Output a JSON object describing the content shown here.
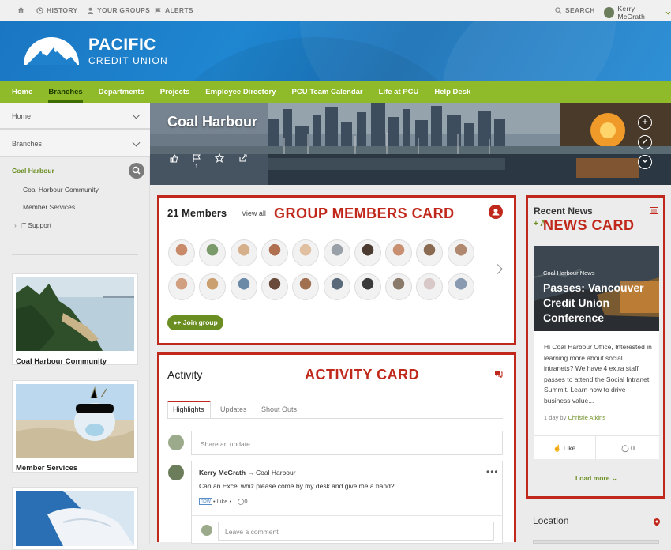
{
  "topbar": {
    "history": "HISTORY",
    "your_groups": "YOUR GROUPS",
    "alerts": "ALERTS",
    "search": "SEARCH",
    "user": "Kerry McGrath"
  },
  "brand": {
    "name": "PACIFIC",
    "subtitle": "CREDIT UNION"
  },
  "nav": [
    "Home",
    "Branches",
    "Departments",
    "Projects",
    "Employee Directory",
    "PCU Team Calendar",
    "Life at PCU",
    "Help Desk"
  ],
  "sidebar": {
    "home": "Home",
    "branches": "Branches",
    "current": "Coal Harbour",
    "subitems": [
      "Coal Harbour Community",
      "Member Services",
      "IT Support"
    ],
    "tiles": [
      "Coal Harbour Community",
      "Member Services"
    ]
  },
  "hero": {
    "title": "Coal Harbour",
    "flag_count": "1"
  },
  "members": {
    "title": "21 Members",
    "view_all": "View all",
    "join": "Join group",
    "annotation": "GROUP MEMBERS CARD"
  },
  "activity": {
    "title": "Activity",
    "annotation": "ACTIVITY CARD",
    "tabs": [
      "Highlights",
      "Updates",
      "Shout Outs"
    ],
    "share_placeholder": "Share an update",
    "post": {
      "author": "Kerry McGrath",
      "target": "Coal Harbour",
      "text": "Can an Excel whiz please come by my desk and give me a hand?",
      "time": "now",
      "like": "Like",
      "comments": "0"
    },
    "comment_placeholder": "Leave a comment"
  },
  "news": {
    "title": "Recent News",
    "annotation": "NEWS CARD",
    "add_fragment": "+ A",
    "category": "Coal Harbour News",
    "headline": "Passes: Vancouver Credit Union Conference",
    "excerpt": "Hi Coal Harbour Office, Interested in learning more about social intranets? We have 4 extra staff passes to attend the Social Intranet Summit. Learn how to drive business value...",
    "meta_prefix": "1 day by",
    "meta_author": "Christie Atkins",
    "like": "Like",
    "comments": "0",
    "load_more": "Load more"
  },
  "location": {
    "title": "Location"
  },
  "colors": {
    "brand_green": "#8fbb2a",
    "annotation_red": "#c0281b",
    "banner_blue": "#1f86d1"
  }
}
